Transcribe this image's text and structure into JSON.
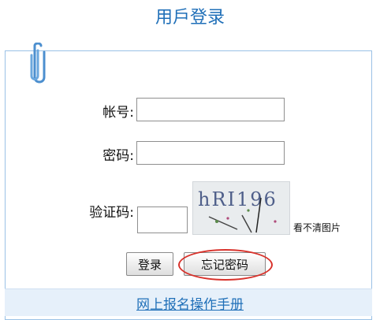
{
  "header": {
    "title": "用戶登录"
  },
  "form": {
    "account_label": "帐号:",
    "account_value": "",
    "password_label": "密码:",
    "password_value": "",
    "captcha_label": "验证码:",
    "captcha_value": "",
    "captcha_text": "hRI196",
    "captcha_refresh_label": "看不清图片"
  },
  "buttons": {
    "login_label": "登录",
    "forgot_label": "忘记密码"
  },
  "footer": {
    "manual_link": "网上报名操作手册"
  },
  "colors": {
    "title_blue": "#1f6fb8",
    "panel_border": "#9ac1e6",
    "highlight_red": "#d8322b"
  },
  "icons": [
    "paperclip-icon"
  ]
}
